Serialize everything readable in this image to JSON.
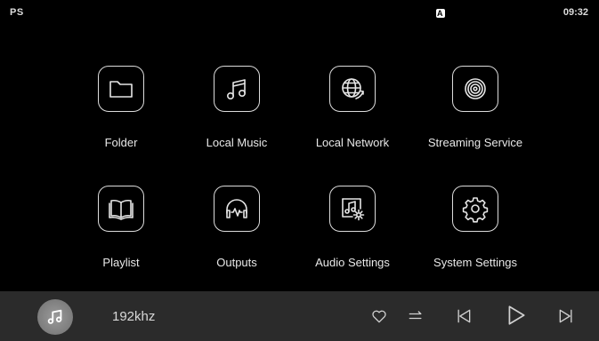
{
  "status_bar": {
    "left_text": "PS",
    "badge": "A",
    "time": "09:32"
  },
  "apps": [
    {
      "label": "Folder",
      "icon": "folder-icon"
    },
    {
      "label": "Local Music",
      "icon": "music-note-icon"
    },
    {
      "label": "Local Network",
      "icon": "globe-network-icon"
    },
    {
      "label": "Streaming Service",
      "icon": "disc-icon"
    },
    {
      "label": "Playlist",
      "icon": "book-icon"
    },
    {
      "label": "Outputs",
      "icon": "headphones-icon"
    },
    {
      "label": "Audio Settings",
      "icon": "music-gear-icon"
    },
    {
      "label": "System Settings",
      "icon": "gear-icon"
    }
  ],
  "player": {
    "sample_rate": "192khz",
    "album_art_icon": "music-note-icon",
    "controls": [
      "heart-icon",
      "queue-icon",
      "previous-icon",
      "play-icon",
      "next-icon"
    ]
  },
  "colors": {
    "background": "#000000",
    "player_bar": "#2b2b2b",
    "foreground": "#e6e6e6"
  }
}
